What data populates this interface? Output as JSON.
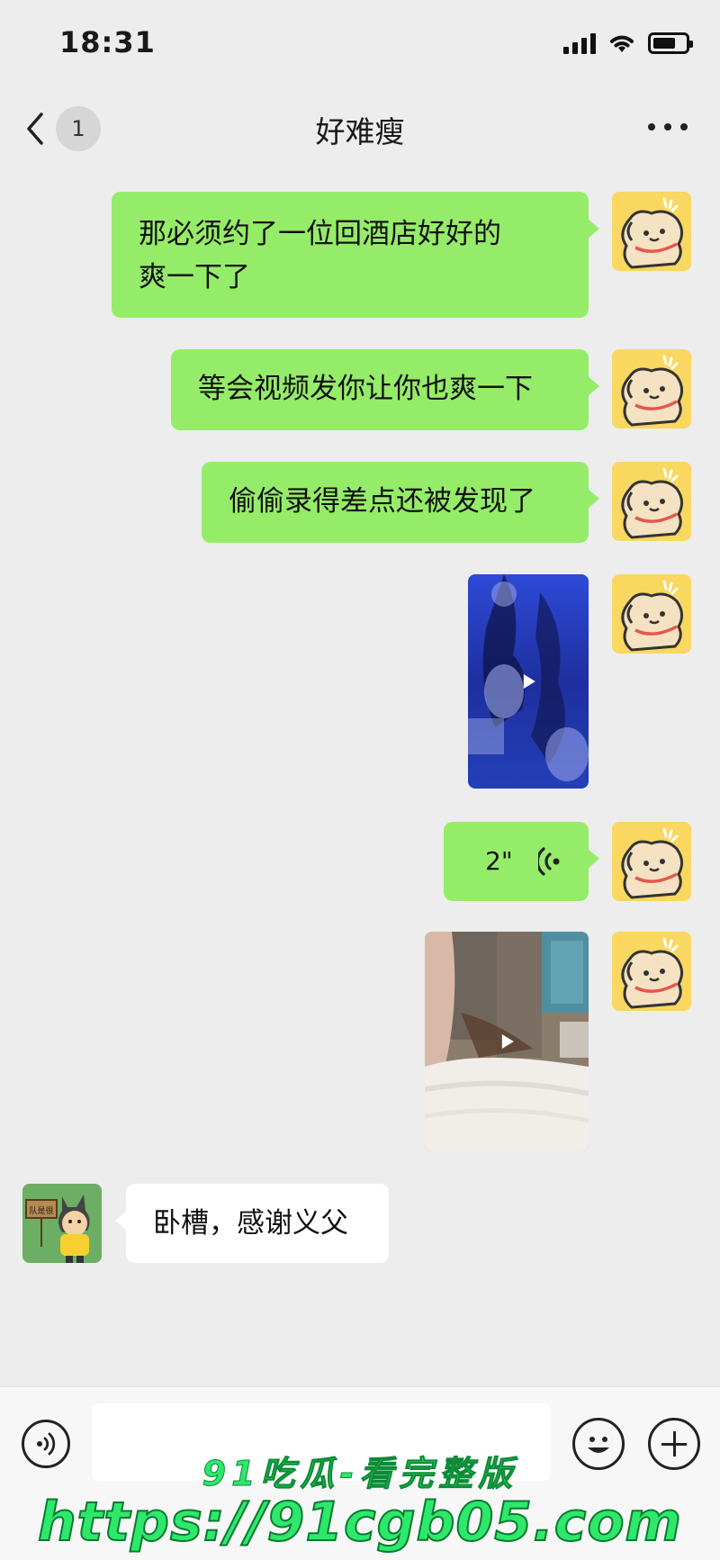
{
  "status_bar": {
    "time": "18:31"
  },
  "nav": {
    "unread_count": "1",
    "title": "好难瘦"
  },
  "messages": [
    {
      "side": "right",
      "type": "text",
      "lines": [
        "那必须约了一位回酒店好好的",
        "爽一下了"
      ]
    },
    {
      "side": "right",
      "type": "text",
      "text": "等会视频发你让你也爽一下"
    },
    {
      "side": "right",
      "type": "text",
      "text": "偷偷录得差点还被发现了"
    },
    {
      "side": "right",
      "type": "video"
    },
    {
      "side": "right",
      "type": "voice",
      "duration": "2\""
    },
    {
      "side": "right",
      "type": "video"
    },
    {
      "side": "left",
      "type": "text",
      "text": "卧槽，感谢义父",
      "avatar_sign": "队是很"
    }
  ],
  "watermark": {
    "line1": "91吃瓜-看完整版",
    "line2": "https://91cgb05.com"
  },
  "colors": {
    "sent_bubble": "#95ec69",
    "background": "#ededed",
    "watermark": "#2ee86b"
  }
}
